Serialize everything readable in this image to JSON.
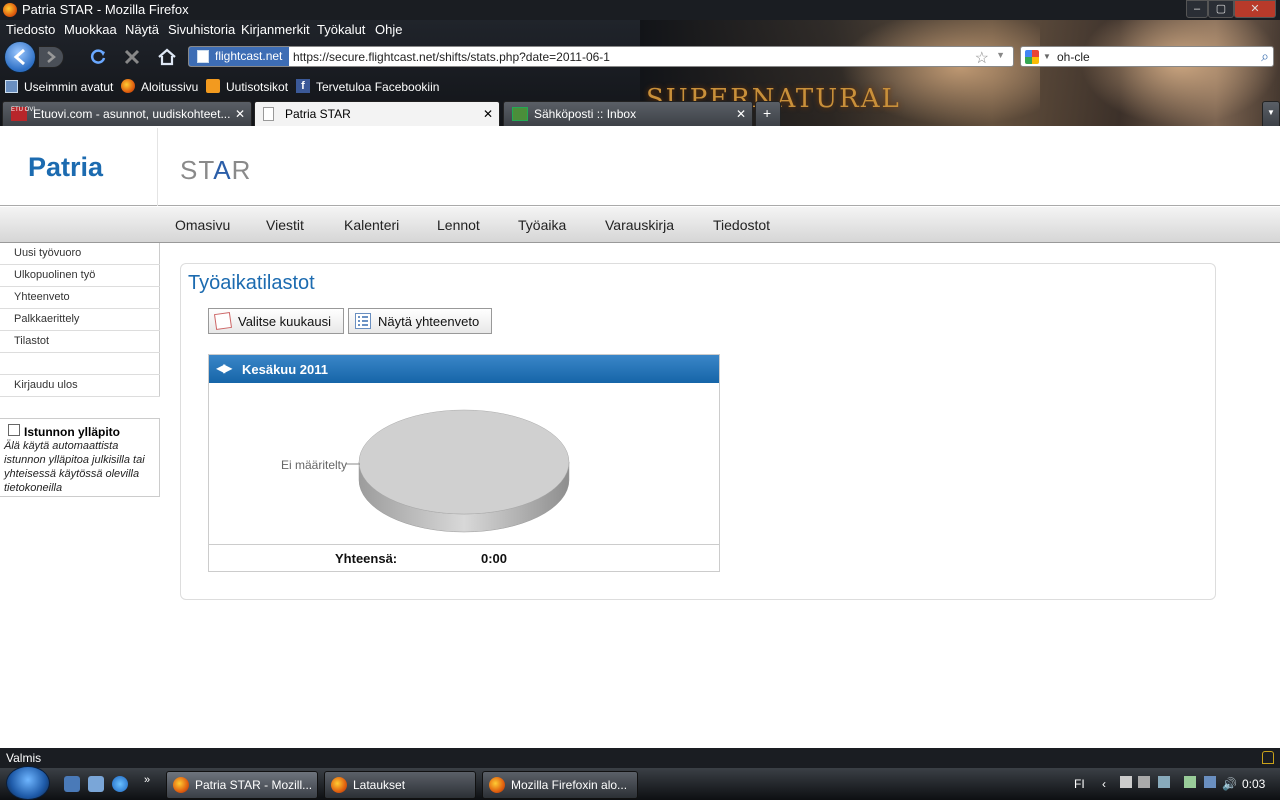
{
  "window": {
    "title": "Patria STAR - Mozilla Firefox"
  },
  "menubar": [
    "Tiedosto",
    "Muokkaa",
    "Näytä",
    "Sivuhistoria",
    "Kirjanmerkit",
    "Työkalut",
    "Ohje"
  ],
  "navbar": {
    "site_identity": "flightcast.net",
    "url": "https://secure.flightcast.net/shifts/stats.php?date=2011-06-1",
    "search_value": "oh-cle"
  },
  "bookmarks": [
    "Useimmin avatut",
    "Aloitussivu",
    "Uutisotsikot",
    "Tervetuloa Facebookiin"
  ],
  "banner_text": "SUPERNATURAL",
  "tabs": [
    {
      "label": "Etuovi.com - asunnot, uudiskohteet..."
    },
    {
      "label": "Patria STAR"
    },
    {
      "label": "Sähköposti :: Inbox"
    }
  ],
  "site": {
    "logo": "Patria",
    "product_pre": "ST",
    "product_a": "A",
    "product_post": "R",
    "nav": [
      "Omasivu",
      "Viestit",
      "Kalenteri",
      "Lennot",
      "Työaika",
      "Varauskirja",
      "Tiedostot"
    ],
    "sidebar": [
      "Uusi työvuoro",
      "Ulkopuolinen työ",
      "Yhteenveto",
      "Palkkaerittely",
      "Tilastot",
      "",
      "Kirjaudu ulos"
    ],
    "session": {
      "label": "Istunnon ylläpito",
      "note": "Älä käytä automaattista istunnon ylläpitoa julkisilla tai yhteisessä käytössä olevilla tietokoneilla",
      "checked": false
    }
  },
  "content": {
    "title": "Työaikatilastot",
    "choose_month_button": "Valitse kuukausi",
    "show_summary_button": "Näytä yhteenveto",
    "panel_title": "Kesäkuu 2011",
    "total_label": "Yhteensä:",
    "total_value": "0:00"
  },
  "chart_data": {
    "type": "pie",
    "categories": [
      "Ei määritelty"
    ],
    "values": [
      1
    ],
    "slice_color": "#d0d0d0"
  },
  "statusbar": {
    "text": "Valmis"
  },
  "taskbar": {
    "tasks": [
      "Patria STAR - Mozill...",
      "Lataukset",
      "Mozilla Firefoxin alo..."
    ],
    "language": "FI",
    "clock": "0:03"
  }
}
